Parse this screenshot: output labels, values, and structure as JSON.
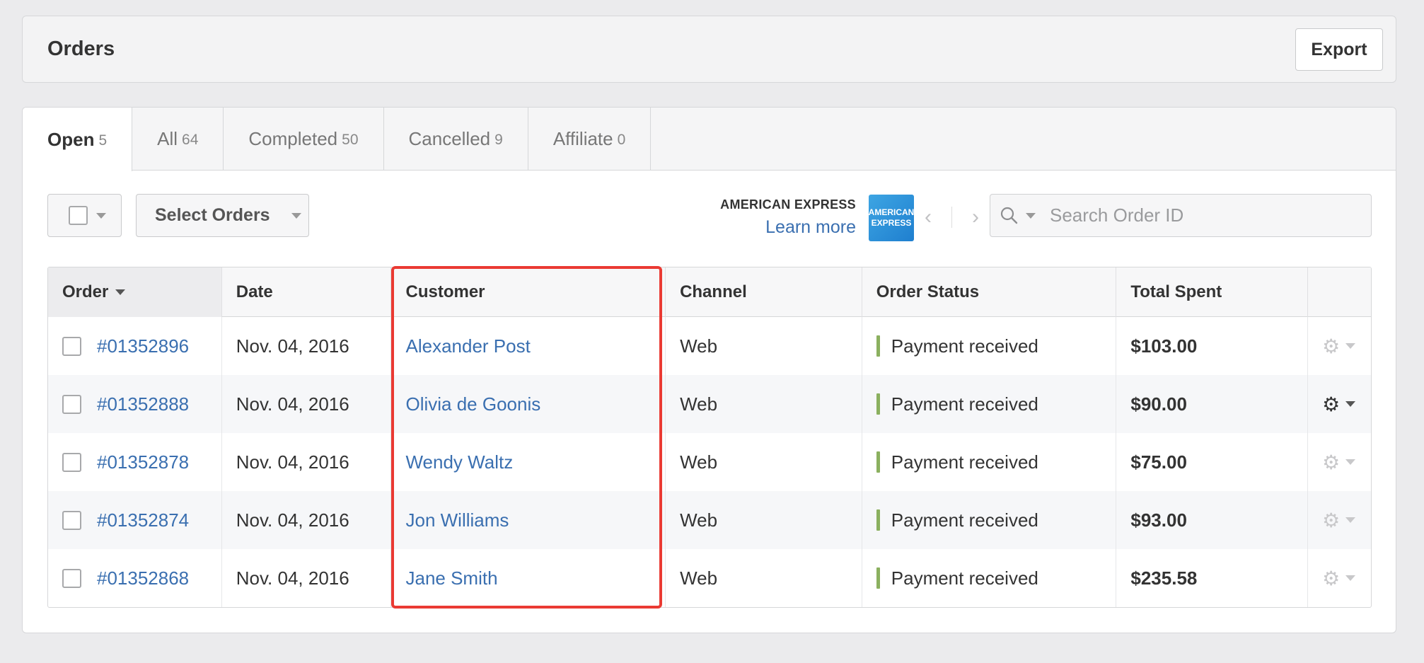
{
  "header": {
    "title": "Orders",
    "export_label": "Export"
  },
  "tabs": [
    {
      "label": "Open",
      "count": "5"
    },
    {
      "label": "All",
      "count": "64"
    },
    {
      "label": "Completed",
      "count": "50"
    },
    {
      "label": "Cancelled",
      "count": "9"
    },
    {
      "label": "Affiliate",
      "count": "0"
    }
  ],
  "toolbar": {
    "select_orders_label": "Select Orders",
    "amex_title": "AMERICAN EXPRESS",
    "amex_link": "Learn more",
    "amex_logo": "AMERICAN EXPRESS",
    "prev_icon": "‹",
    "next_icon": "›",
    "search_placeholder": "Search Order ID"
  },
  "table": {
    "columns": [
      "Order",
      "Date",
      "Customer",
      "Channel",
      "Order Status",
      "Total Spent"
    ],
    "rows": [
      {
        "order": "#01352896",
        "date": "Nov. 04, 2016",
        "customer": "Alexander Post",
        "channel": "Web",
        "status": "Payment received",
        "total": "$103.00"
      },
      {
        "order": "#01352888",
        "date": "Nov. 04, 2016",
        "customer": "Olivia de Goonis",
        "channel": "Web",
        "status": "Payment received",
        "total": "$90.00"
      },
      {
        "order": "#01352878",
        "date": "Nov. 04, 2016",
        "customer": "Wendy Waltz",
        "channel": "Web",
        "status": "Payment received",
        "total": "$75.00"
      },
      {
        "order": "#01352874",
        "date": "Nov. 04, 2016",
        "customer": "Jon Williams",
        "channel": "Web",
        "status": "Payment received",
        "total": "$93.00"
      },
      {
        "order": "#01352868",
        "date": "Nov. 04, 2016",
        "customer": "Jane Smith",
        "channel": "Web",
        "status": "Payment received",
        "total": "$235.58"
      }
    ]
  },
  "colors": {
    "link": "#3a6fb0",
    "status": "#8bb05f",
    "highlight": "#ea3a33"
  }
}
